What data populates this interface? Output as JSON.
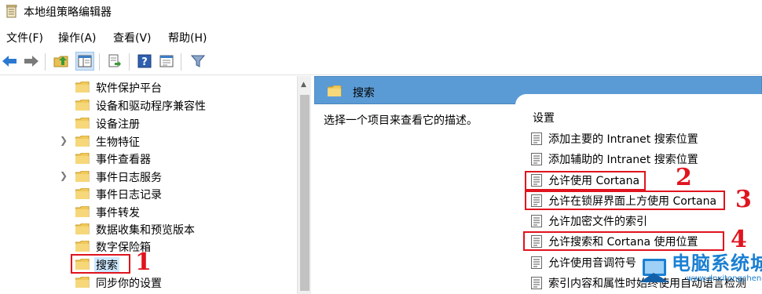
{
  "window": {
    "title": "本地组策略编辑器"
  },
  "menu": [
    "文件(F)",
    "操作(A)",
    "查看(V)",
    "帮助(H)"
  ],
  "toolbar": {
    "icons": [
      "back-arrow-icon",
      "forward-arrow-icon",
      "up-folder-icon",
      "show-hide-tree-icon",
      "export-list-icon",
      "help-icon",
      "properties-icon",
      "filter-icon"
    ]
  },
  "tree": {
    "items": [
      {
        "label": "软件保护平台",
        "expandable": false
      },
      {
        "label": "设备和驱动程序兼容性",
        "expandable": false
      },
      {
        "label": "设备注册",
        "expandable": false
      },
      {
        "label": "生物特征",
        "expandable": true
      },
      {
        "label": "事件查看器",
        "expandable": false
      },
      {
        "label": "事件日志服务",
        "expandable": true
      },
      {
        "label": "事件日志记录",
        "expandable": false
      },
      {
        "label": "事件转发",
        "expandable": false
      },
      {
        "label": "数据收集和预览版本",
        "expandable": false
      },
      {
        "label": "数字保险箱",
        "expandable": false
      },
      {
        "label": "搜索",
        "expandable": false,
        "selected": true
      },
      {
        "label": "同步你的设置",
        "expandable": false
      }
    ]
  },
  "right": {
    "header": "搜索",
    "description": "选择一个项目来查看它的描述。",
    "column_header": "设置",
    "settings": [
      "添加主要的 Intranet 搜索位置",
      "添加辅助的 Intranet 搜索位置",
      "允许使用 Cortana",
      "允许在锁屏界面上方使用 Cortana",
      "允许加密文件的索引",
      "允许搜索和 Cortana 使用位置",
      "允许使用音调符号",
      "索引内容和属性时始终使用自动语言检测"
    ]
  },
  "annotations": {
    "n1": "1",
    "n2": "2",
    "n3": "3",
    "n4": "4",
    "color": "#e0141e"
  },
  "watermark": {
    "brand": "电脑系统城",
    "url": "www.dnxitongcheng.com"
  }
}
